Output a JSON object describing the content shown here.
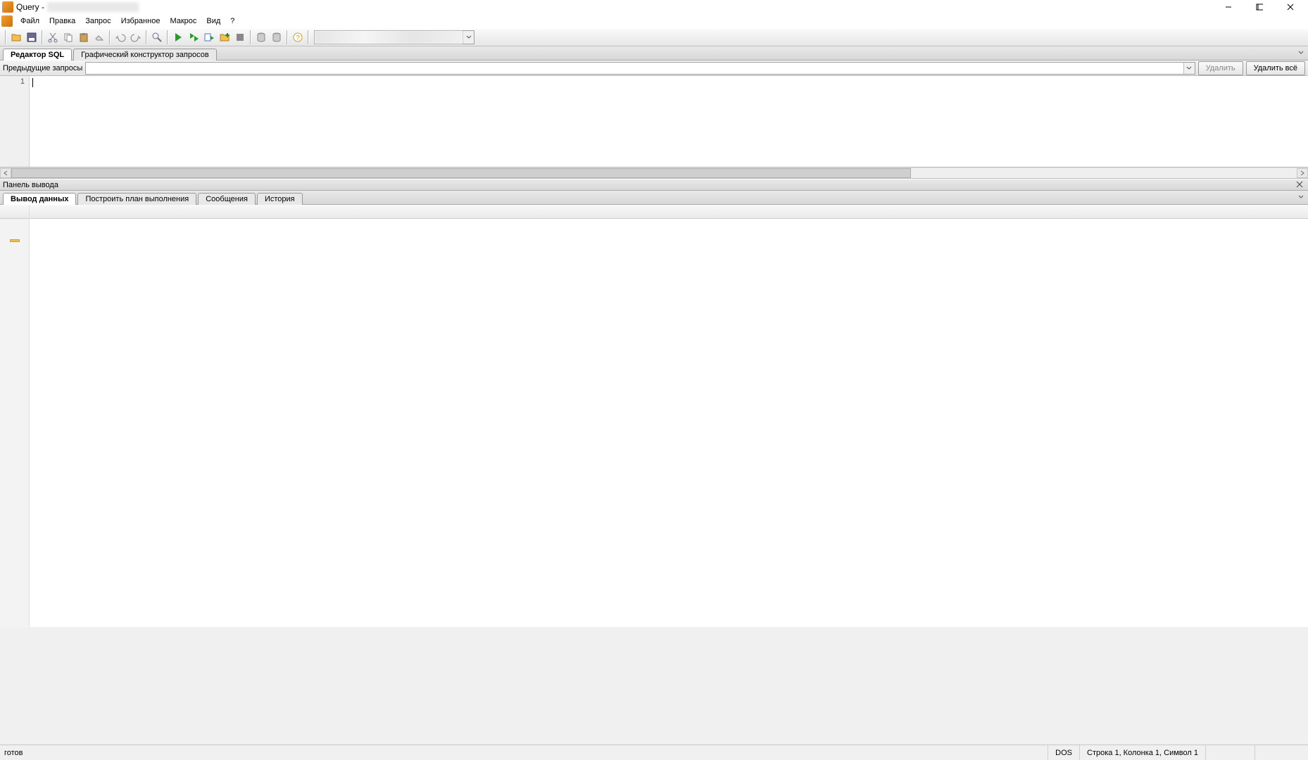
{
  "window": {
    "title": "Query -"
  },
  "window_controls": {
    "minimize": "–",
    "maximize": "❐",
    "close": "✕"
  },
  "menu": {
    "file": "Файл",
    "edit": "Правка",
    "query": "Запрос",
    "favorites": "Избранное",
    "macros": "Макрос",
    "view": "Вид",
    "help": "?"
  },
  "toolbar": {
    "icons": {
      "open": "open-icon",
      "save": "save-icon",
      "cut": "cut-icon",
      "copy": "copy-icon",
      "paste": "paste-icon",
      "clear": "clear-icon",
      "undo": "undo-icon",
      "redo": "redo-icon",
      "find": "find-icon",
      "run": "run-icon",
      "run_script": "run-script-icon",
      "favorites_run": "favorites-run-icon",
      "favorites_add": "favorites-add-icon",
      "stop": "stop-icon",
      "db1": "database-icon",
      "db2": "database-icon",
      "help": "help-icon",
      "options": "options-icon"
    },
    "connection_combo": ""
  },
  "upper_tabs": {
    "sql_editor": "Редактор SQL",
    "graphical_builder": "Графический конструктор запросов"
  },
  "previous_queries": {
    "label": "Предыдущие запросы",
    "delete": "Удалить",
    "delete_all": "Удалить всё"
  },
  "editor": {
    "line_number": "1",
    "content": ""
  },
  "output_panel": {
    "title": "Панель вывода"
  },
  "lower_tabs": {
    "data_output": "Вывод данных",
    "explain": "Построить план выполнения",
    "messages": "Сообщения",
    "history": "История"
  },
  "statusbar": {
    "ready": "готов",
    "encoding": "DOS",
    "position": "Строка 1, Колонка 1, Символ 1"
  }
}
